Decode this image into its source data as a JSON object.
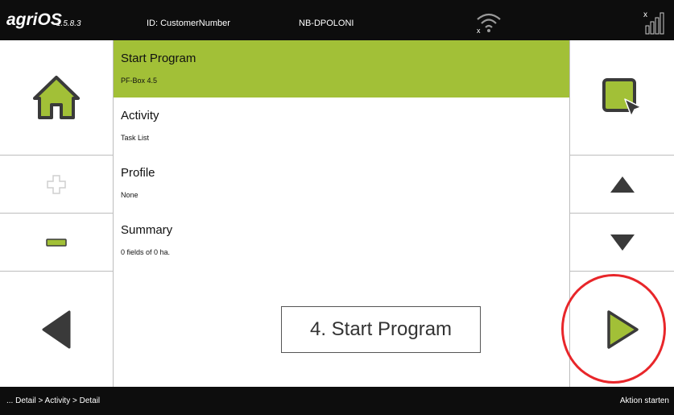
{
  "header": {
    "brand": "agriOS",
    "version": "1.5.8.3",
    "device_id": "ID: CustomerNumber",
    "device_name": "NB-DPOLONI",
    "wifi_icon": "wifi-disconnected-icon",
    "signal_icon": "signal-none-icon"
  },
  "left_panel": {
    "home_icon": "home-icon",
    "plus_icon": "plus-icon",
    "minus_icon": "minus-icon",
    "back_icon": "arrow-left-icon"
  },
  "right_panel": {
    "select_icon": "select-pointer-icon",
    "up_icon": "arrow-up-icon",
    "down_icon": "arrow-down-icon",
    "start_icon": "play-icon"
  },
  "list": [
    {
      "title": "Start Program",
      "subtitle": "PF-Box 4.5",
      "selected": true
    },
    {
      "title": "Activity",
      "subtitle": "Task List",
      "selected": false
    },
    {
      "title": "Profile",
      "subtitle": "None",
      "selected": false
    },
    {
      "title": "Summary",
      "subtitle": "0 fields of 0 ha.",
      "selected": false
    }
  ],
  "callout": {
    "text": "4. Start Program"
  },
  "footer": {
    "breadcrumb": "... Detail > Activity > Detail",
    "action": "Aktion starten"
  },
  "colors": {
    "accent": "#a2c037",
    "bar": "#0d0d0d",
    "highlight": "#e8262a",
    "icon_dark": "#3a3a3a"
  }
}
